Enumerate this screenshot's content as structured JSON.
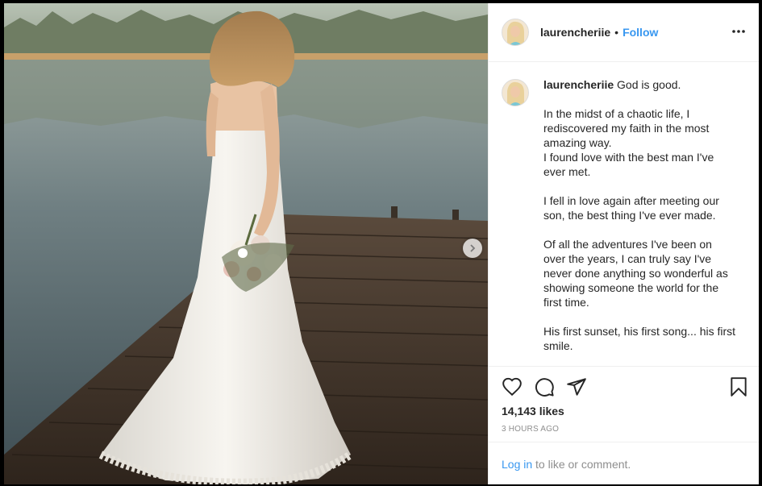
{
  "post": {
    "username": "laurencheriie",
    "separator": "•",
    "follow_label": "Follow",
    "more_icon": "more-horizontal-icon",
    "carousel_next_icon": "chevron-right-icon"
  },
  "caption": {
    "username": "laurencheriie",
    "first_line": "God is good.",
    "paragraphs": [
      [
        "In the midst of a chaotic life, I rediscovered my faith in the most amazing way.",
        "I found love with the best man I've ever met."
      ],
      [
        "I fell in love again after meeting our son, the best thing I've ever made."
      ],
      [
        "Of all the adventures I've been on over the years, I can truly say I've never done anything so wonderful as showing someone the world for the first time."
      ],
      [
        "His first sunset, his first song... his first smile."
      ]
    ]
  },
  "actions": {
    "like_icon": "heart-icon",
    "comment_icon": "comment-icon",
    "share_icon": "share-icon",
    "save_icon": "bookmark-icon",
    "likes_text": "14,143 likes",
    "time_text": "3 HOURS AGO"
  },
  "login": {
    "link_label": "Log in",
    "rest_text": " to like or comment."
  },
  "colors": {
    "link_blue": "#3897f0",
    "text": "#262626",
    "muted": "#8e8e8e",
    "divider": "#efefef"
  }
}
